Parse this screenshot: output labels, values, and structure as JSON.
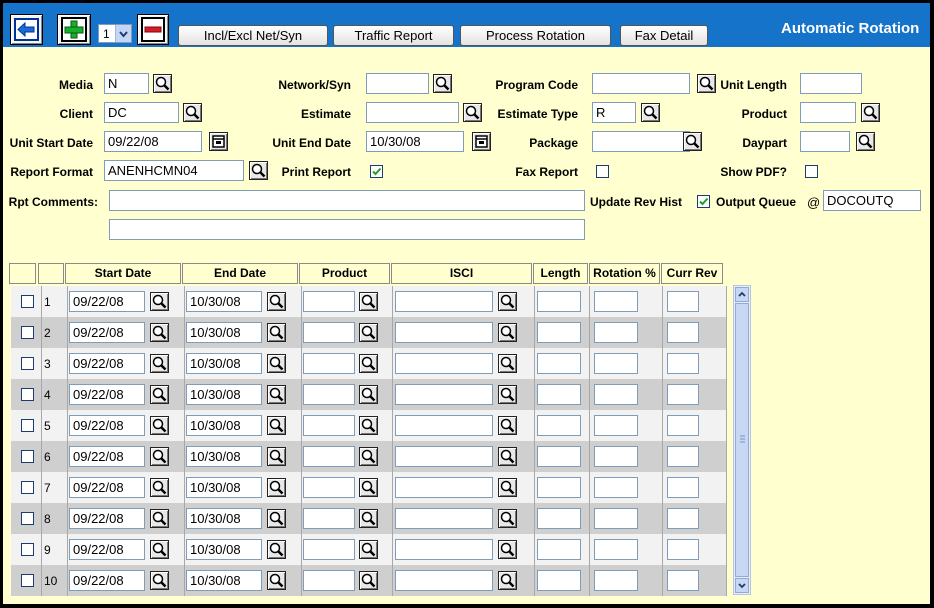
{
  "toolbar": {
    "page_select_value": "1",
    "buttons": [
      "Incl/Excl Net/Syn",
      "Traffic Report",
      "Process Rotation",
      "Fax Detail"
    ],
    "title": "Automatic Rotation"
  },
  "form": {
    "media_label": "Media",
    "media_value": "N",
    "network_label": "Network/Syn",
    "network_value": "",
    "program_code_label": "Program Code",
    "program_code_value": "",
    "unit_length_label": "Unit Length",
    "unit_length_value": "",
    "client_label": "Client",
    "client_value": "DC",
    "estimate_label": "Estimate",
    "estimate_value": "",
    "estimate_type_label": "Estimate Type",
    "estimate_type_value": "R",
    "product_label": "Product",
    "product_value": "",
    "unit_start_label": "Unit Start Date",
    "unit_start_value": "09/22/08",
    "unit_end_label": "Unit End Date",
    "unit_end_value": "10/30/08",
    "package_label": "Package",
    "package_value": "",
    "daypart_label": "Daypart",
    "daypart_value": "",
    "report_format_label": "Report Format",
    "report_format_value": "ANENHCMN04",
    "print_report_label": "Print Report",
    "print_report_checked": true,
    "fax_report_label": "Fax Report",
    "fax_report_checked": false,
    "show_pdf_label": "Show PDF?",
    "show_pdf_checked": false,
    "rpt_comments_label": "Rpt Comments:",
    "rpt_comments_1": "",
    "rpt_comments_2": "",
    "update_rev_label": "Update Rev Hist",
    "update_rev_checked": true,
    "output_queue_label": "Output Queue",
    "output_queue_prefix": "@",
    "output_queue_value": "DOCOUTQ"
  },
  "grid": {
    "columns": [
      "Start Date",
      "End Date",
      "Product",
      "ISCI",
      "Length",
      "Rotation %",
      "Curr Rev"
    ],
    "rows": [
      {
        "num": "1",
        "start": "09/22/08",
        "end": "10/30/08"
      },
      {
        "num": "2",
        "start": "09/22/08",
        "end": "10/30/08"
      },
      {
        "num": "3",
        "start": "09/22/08",
        "end": "10/30/08"
      },
      {
        "num": "4",
        "start": "09/22/08",
        "end": "10/30/08"
      },
      {
        "num": "5",
        "start": "09/22/08",
        "end": "10/30/08"
      },
      {
        "num": "6",
        "start": "09/22/08",
        "end": "10/30/08"
      },
      {
        "num": "7",
        "start": "09/22/08",
        "end": "10/30/08"
      },
      {
        "num": "8",
        "start": "09/22/08",
        "end": "10/30/08"
      },
      {
        "num": "9",
        "start": "09/22/08",
        "end": "10/30/08"
      },
      {
        "num": "10",
        "start": "09/22/08",
        "end": "10/30/08"
      }
    ]
  },
  "colors": {
    "toolbar_bg": "#1573c9",
    "page_bg": "#ffffd0",
    "row_even": "#cfcfcf",
    "row_odd": "#f2f2f2"
  },
  "icons": {
    "back": "back-arrow-icon",
    "add": "plus-icon",
    "remove": "minus-icon",
    "search": "magnifier-icon",
    "calendar": "calendar-icon",
    "check": "checkmark-icon"
  }
}
